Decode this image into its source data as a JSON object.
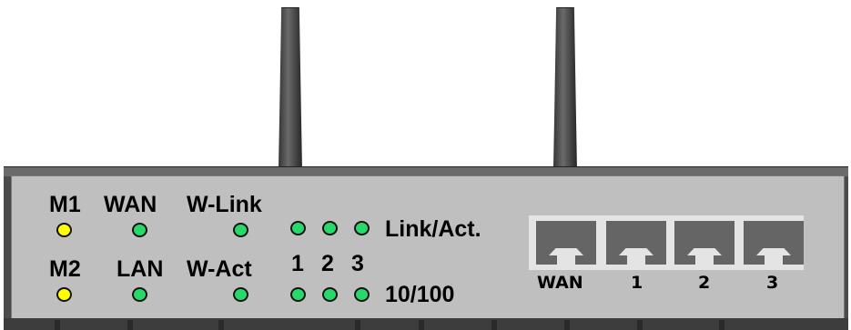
{
  "led_labels": {
    "m1": "M1",
    "wan": "WAN",
    "wlink": "W-Link",
    "m2": "M2",
    "lan": "LAN",
    "wact": "W-Act",
    "link_act": "Link/Act.",
    "speed": "10/100",
    "port1": "1",
    "port2": "2",
    "port3": "3"
  },
  "port_labels": [
    "WAN",
    "1",
    "2",
    "3"
  ],
  "colors": {
    "led_green": "#27d96a",
    "led_yellow": "#ffff00",
    "panel": "#bfbfbf",
    "chassis": "#4b4b4b"
  }
}
